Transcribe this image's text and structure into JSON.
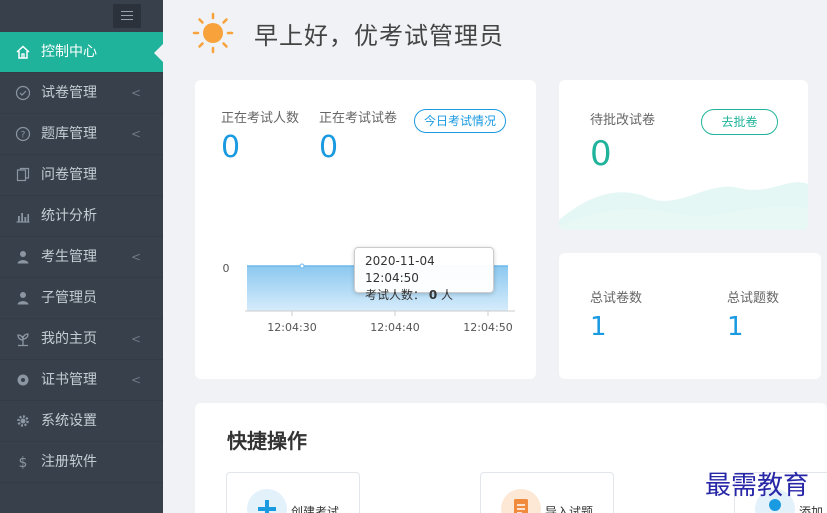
{
  "sidebar": {
    "items": [
      {
        "label": "控制中心",
        "icon": "home-icon",
        "active": true,
        "caret": false
      },
      {
        "label": "试卷管理",
        "icon": "check-circle-icon",
        "active": false,
        "caret": true
      },
      {
        "label": "题库管理",
        "icon": "question-circle-icon",
        "active": false,
        "caret": true
      },
      {
        "label": "问卷管理",
        "icon": "copy-icon",
        "active": false,
        "caret": false
      },
      {
        "label": "统计分析",
        "icon": "bar-chart-icon",
        "active": false,
        "caret": false
      },
      {
        "label": "考生管理",
        "icon": "user-icon",
        "active": false,
        "caret": true
      },
      {
        "label": "子管理员",
        "icon": "user-icon",
        "active": false,
        "caret": false
      },
      {
        "label": "我的主页",
        "icon": "leaf-icon",
        "active": false,
        "caret": true
      },
      {
        "label": "证书管理",
        "icon": "badge-icon",
        "active": false,
        "caret": true
      },
      {
        "label": "系统设置",
        "icon": "gear-icon",
        "active": false,
        "caret": false
      },
      {
        "label": "注册软件",
        "icon": "dollar-icon",
        "active": false,
        "caret": false
      }
    ],
    "caret_glyph": "<"
  },
  "header": {
    "greeting": "早上好，优考试管理员"
  },
  "exam_card": {
    "examinees_label": "正在考试人数",
    "examinees_value": "0",
    "papers_label": "正在考试试卷",
    "papers_value": "0",
    "today_button": "今日考试情况",
    "chart": {
      "y_tick": "0",
      "x_ticks": [
        "12:04:30",
        "12:04:40",
        "12:04:50"
      ],
      "tooltip_time": "2020-11-04 12:04:50",
      "tooltip_label": "考试人数：",
      "tooltip_value": "0",
      "tooltip_unit": "人"
    }
  },
  "chart_data": {
    "type": "area",
    "x": [
      "12:04:30",
      "12:04:40",
      "12:04:50"
    ],
    "series": [
      {
        "values": [
          0,
          0,
          0
        ]
      }
    ],
    "xlabel": "",
    "ylabel": "",
    "ylim": [
      0,
      0
    ]
  },
  "grading_card": {
    "label": "待批改试卷",
    "value": "0",
    "button": "去批卷"
  },
  "totals_card": {
    "papers_label": "总试卷数",
    "papers_value": "1",
    "questions_label": "总试题数",
    "questions_value": "1"
  },
  "quick": {
    "title": "快捷操作",
    "buttons": [
      {
        "label": "创建考试",
        "icon": "plus-icon",
        "color": "#1a9ae0"
      },
      {
        "label": "导入试题",
        "icon": "document-icon",
        "color": "#f08a3c"
      },
      {
        "label": "添加",
        "icon": "user-icon",
        "color": "#1a9ae0"
      }
    ]
  },
  "colors": {
    "accent": "#1fb39b",
    "blue": "#1a9ae0",
    "sidebar": "#37404b"
  },
  "watermark": "最需教育"
}
